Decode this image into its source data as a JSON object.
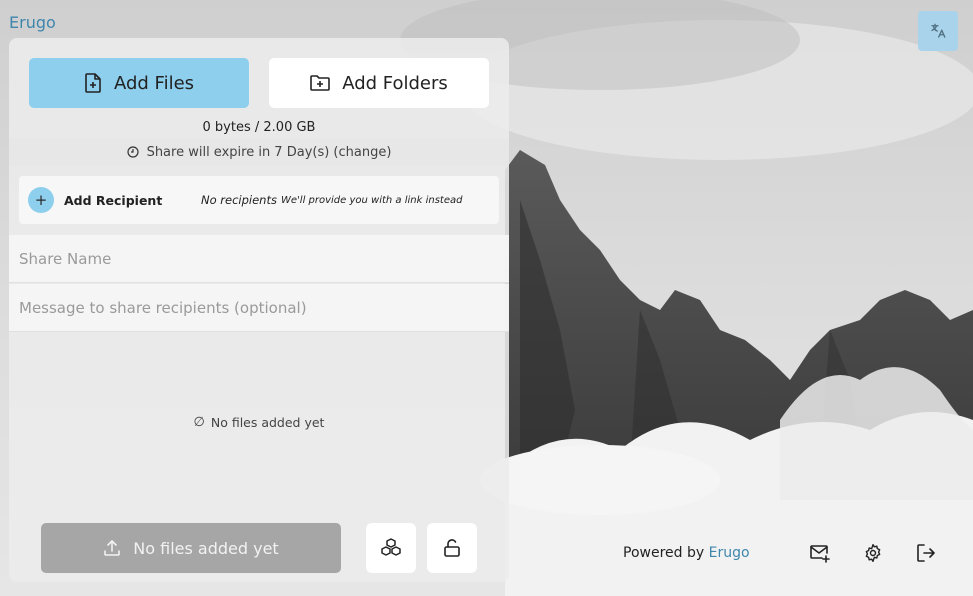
{
  "brand": {
    "name": "Erugo"
  },
  "uploader": {
    "add_files_label": "Add Files",
    "add_folders_label": "Add Folders",
    "size_usage": "0 bytes / 2.00 GB",
    "expiry_text": "Share will expire in 7 Day(s) (change)",
    "recipients": {
      "add_label": "Add Recipient",
      "none_label": "No recipients",
      "hint": "We'll provide you with a link instead"
    },
    "share_name_placeholder": "Share Name",
    "message_placeholder": "Message to share recipients (optional)",
    "empty_files": "No files added yet",
    "upload_button_label": "No files added yet"
  },
  "footer": {
    "powered_by": "Powered by",
    "powered_link": "Erugo"
  },
  "icons": {
    "translate": "translate-icon",
    "file_plus": "file-plus-icon",
    "folder_plus": "folder-plus-icon",
    "clock": "clock-icon",
    "plus": "plus-icon",
    "empty": "empty-set-icon",
    "upload": "upload-icon",
    "bundle": "bundle-icon",
    "lock_open": "lock-open-icon",
    "mail_plus": "mail-plus-icon",
    "settings": "gear-icon",
    "logout": "logout-icon"
  },
  "colors": {
    "accent": "#8ecfee",
    "brand": "#3f86ad",
    "disabled": "#a6a6a6"
  }
}
